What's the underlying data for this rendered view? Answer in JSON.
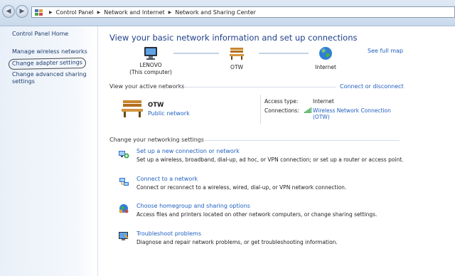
{
  "address": {
    "crumbs": [
      "Control Panel",
      "Network and Internet",
      "Network and Sharing Center"
    ]
  },
  "sidebar": {
    "home": "Control Panel Home",
    "items": [
      {
        "label": "Manage wireless networks"
      },
      {
        "label": "Change adapter settings"
      },
      {
        "label": "Change advanced sharing settings"
      }
    ]
  },
  "main": {
    "heading": "View your basic network information and set up connections",
    "see_full_map": "See full map",
    "nodes": [
      {
        "name": "LENOVO",
        "sub": "(This computer)",
        "icon": "computer-icon"
      },
      {
        "name": "OTW",
        "sub": "",
        "icon": "bench-icon"
      },
      {
        "name": "Internet",
        "sub": "",
        "icon": "globe-icon"
      }
    ],
    "active": {
      "title": "View your active networks",
      "connect_link": "Connect or disconnect",
      "network_name": "OTW",
      "network_type": "Public network",
      "access_type_label": "Access type:",
      "access_type_value": "Internet",
      "connections_label": "Connections:",
      "connections_value_line1": "Wireless Network Connection",
      "connections_value_line2": "(OTW)"
    },
    "settings": {
      "title": "Change your networking settings",
      "tasks": [
        {
          "title": "Set up a new connection or network",
          "desc": "Set up a wireless, broadband, dial-up, ad hoc, or VPN connection; or set up a router or access point.",
          "icon": "new-connection-icon"
        },
        {
          "title": "Connect to a network",
          "desc": "Connect or reconnect to a wireless, wired, dial-up, or VPN network connection.",
          "icon": "connect-network-icon"
        },
        {
          "title": "Choose homegroup and sharing options",
          "desc": "Access files and printers located on other network computers, or change sharing settings.",
          "icon": "homegroup-icon"
        },
        {
          "title": "Troubleshoot problems",
          "desc": "Diagnose and repair network problems, or get troubleshooting information.",
          "icon": "troubleshoot-icon"
        }
      ]
    }
  },
  "colors": {
    "link": "#1f5fbf",
    "heading": "#1e3f8a",
    "sidebar_bg": "#e9f0f9"
  }
}
